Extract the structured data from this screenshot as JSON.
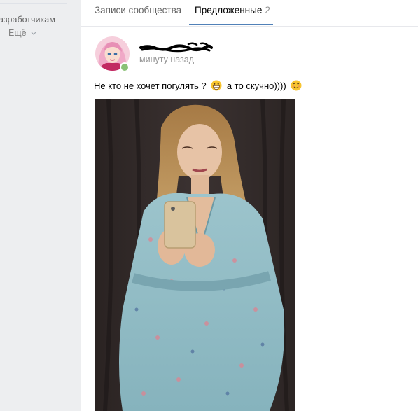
{
  "sidebar": {
    "developers_link": "азработчикам",
    "more_label": "Ещё"
  },
  "tabs": [
    {
      "label": "Записи сообщества",
      "active": false
    },
    {
      "label": "Предложенные",
      "count": "2",
      "active": true
    }
  ],
  "post": {
    "time": "минуту назад",
    "text_part1": "Не кто не хочет погулять ?",
    "text_part2": "а то скучно))))",
    "emojis": [
      "grinning-face-emoji",
      "smiling-face-emoji"
    ]
  },
  "colors": {
    "accent": "#5181b8",
    "online": "#8ac176",
    "page_bg": "#edeef0"
  }
}
